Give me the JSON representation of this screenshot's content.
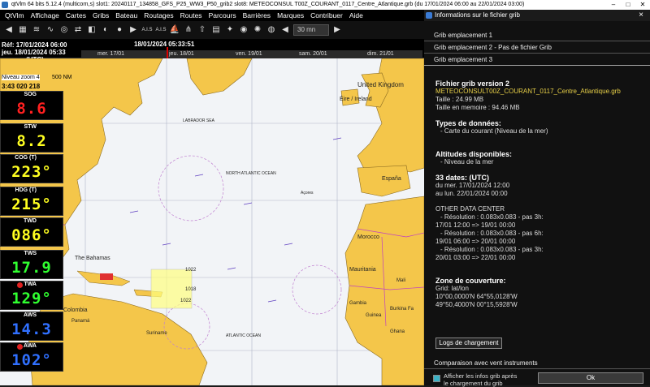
{
  "window": {
    "title": "qtVlm 64 bits 5.12.4 (multicorn,s) slot1: 20240117_134858_GFS_P25_WW3_P50_grib2 slot8: METEOCONSUL T00Z_COURANT_0117_Centre_Atlantique.grb (du 17/01/2024 06:00 au 22/01/2024 03:00)"
  },
  "menu": [
    "QtVlm",
    "Affichage",
    "Cartes",
    "Gribs",
    "Bateau",
    "Routages",
    "Routes",
    "Parcours",
    "Barrières",
    "Marques",
    "Contribuer",
    "Aide"
  ],
  "toolbar": {
    "step_value": "30 mn",
    "label_1": "A.I.S",
    "label_2": "A.I.S"
  },
  "timebar": {
    "ref_line1": "Réf: 17/01/2024 06:00",
    "ref_line2": "jeu. 18/01/2024 05:33",
    "ref_line3": "(UTC)",
    "current": "18/01/2024 05:33:51",
    "days": [
      "mer. 17/01",
      "jeu. 18/01",
      "ven. 19/01",
      "sam. 20/01",
      "dim. 21/01"
    ]
  },
  "map": {
    "zoom_label": "Niveau zoom 4",
    "scale_label": "500 NM",
    "coord_readout": "3:43 020 218",
    "labels": [
      "United Kingdom",
      "Éire / Ireland",
      "LABRADOR SEA",
      "NORTH ATLANTIC OCEAN",
      "Açores",
      "España",
      "Morocco",
      "The Bahamas",
      "Colombia",
      "Mauritania",
      "Mali",
      "Guinea",
      "Burkina Fa",
      "Ghana",
      "Gambia",
      "ATLANTIC OCEAN",
      "Panamá",
      "Suriname",
      "1022",
      "1018",
      "1022"
    ],
    "colors": {
      "land": "#f4c64a",
      "sea": "#f2f4f7",
      "border": "#c040c0"
    }
  },
  "instruments": [
    {
      "label": "SOG",
      "value": "8.6",
      "color": "#ff2020",
      "dot": false
    },
    {
      "label": "STW",
      "value": "8.2",
      "color": "#ffff20",
      "dot": false
    },
    {
      "label": "COG (T)",
      "value": "223°",
      "color": "#ffff20",
      "dot": false
    },
    {
      "label": "HDG (T)",
      "value": "215°",
      "color": "#ffff20",
      "dot": false
    },
    {
      "label": "TWD",
      "value": "086°",
      "color": "#ffff20",
      "dot": false
    },
    {
      "label": "TWS",
      "value": "17.9",
      "color": "#30ff30",
      "dot": false
    },
    {
      "label": "TWA",
      "value": "129°",
      "color": "#30ff30",
      "dot": true
    },
    {
      "label": "AWS",
      "value": "14.3",
      "color": "#3070ff",
      "dot": false
    },
    {
      "label": "AWA",
      "value": "102°",
      "color": "#3070ff",
      "dot": true
    }
  ],
  "panel": {
    "title": "Informations sur le fichier grib",
    "close": "×",
    "tabs": [
      "Grib emplacement 1",
      "Grib emplacement 2 - Pas de fichier Grib",
      "Grib emplacement 3"
    ],
    "heading": "Fichier grib version 2",
    "filename": "METEOCONSULT00Z_COURANT_0117_Centre_Atlantique.grb",
    "size": "Taille : 24.99 MB",
    "memory": "Taille en memoire : 94.46 MB",
    "types_title": "Types de données:",
    "types_value": "- Carte du courant (Niveau de la mer)",
    "alt_title": "Altitudes disponibles:",
    "alt_value": "- Niveau de la mer",
    "dates_title": "33 dates: (UTC)",
    "dates_from": "du mer. 17/01/2024 12:00",
    "dates_to": "au lun. 22/01/2024 00:00",
    "center_title": "OTHER DATA CENTER",
    "res1": "- Résolution : 0.083x0.083 - pas 3h:",
    "res1_range": "17/01 12:00 => 19/01 00:00",
    "res2": "- Résolution : 0.083x0.083 - pas 6h:",
    "res2_range": "19/01 06:00 => 20/01 00:00",
    "res3": "- Résolution : 0.083x0.083 - pas 3h:",
    "res3_range": "20/01 03:00 => 22/01 00:00",
    "zone_title": "Zone de couverture:",
    "zone_grid": "Grid: lat/lon",
    "zone_1": "10°00,0000'N 64°55,0128'W",
    "zone_2": "49°50,4000'N 00°15,5928'W",
    "logs_button": "Logs de chargement",
    "compare_tab": "Comparaison avec vent instruments",
    "checkbox_label_1": "Afficher les infos grib après",
    "checkbox_label_2": "le chargement du grib",
    "ok_button": "Ok"
  }
}
